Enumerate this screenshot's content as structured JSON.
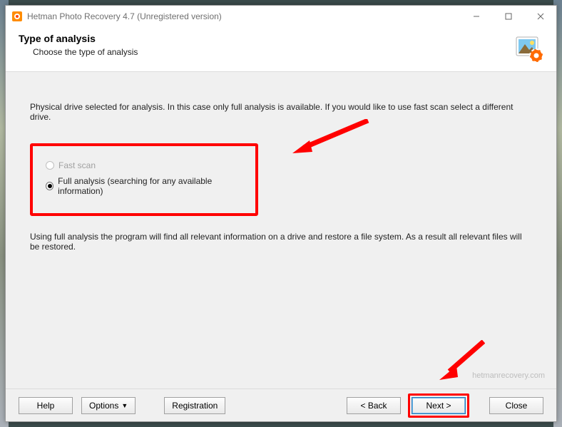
{
  "window": {
    "title": "Hetman Photo Recovery 4.7 (Unregistered version)"
  },
  "header": {
    "title": "Type of analysis",
    "subtitle": "Choose the type of analysis"
  },
  "content": {
    "intro": "Physical drive selected for analysis. In this case only full analysis is available. If you would like to use fast scan select a different drive.",
    "radio_fast": "Fast scan",
    "radio_full": "Full analysis (searching for any available information)",
    "desc": "Using full analysis the program will find all relevant information on a drive and restore a file system. As a result all relevant files will be restored."
  },
  "footer": {
    "help": "Help",
    "options": "Options",
    "registration": "Registration",
    "back": "< Back",
    "next": "Next >",
    "close": "Close"
  },
  "watermark": "hetmanrecovery.com"
}
